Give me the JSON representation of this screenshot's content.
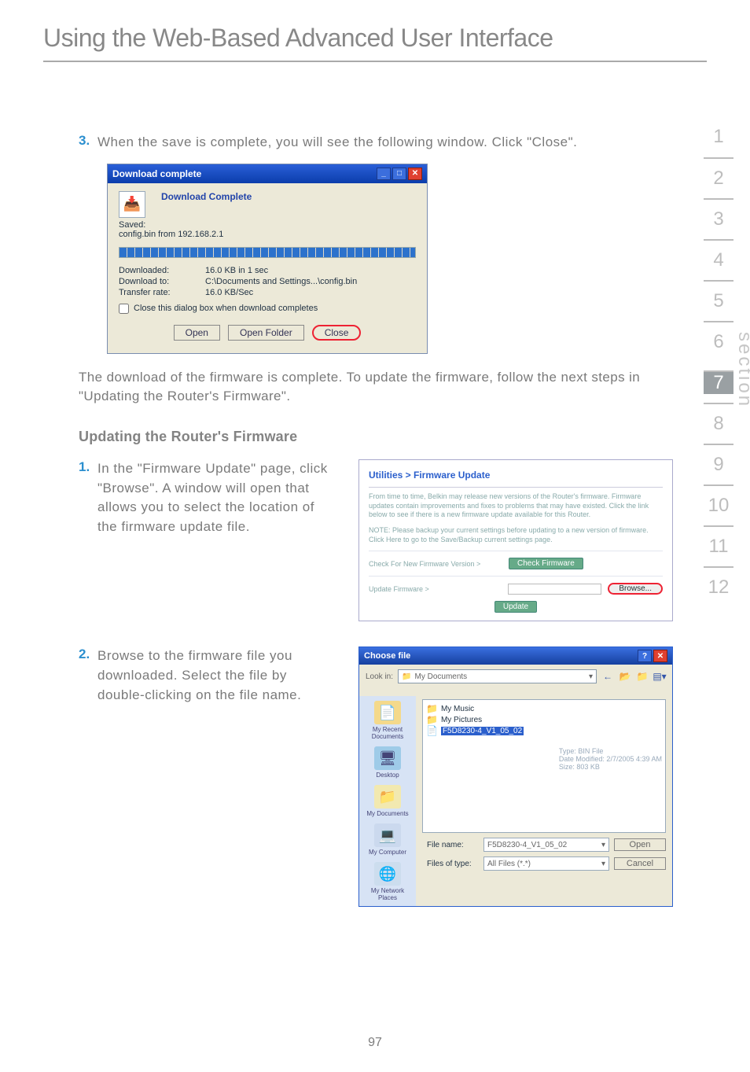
{
  "header": {
    "title": "Using the Web-Based Advanced User Interface"
  },
  "steps": {
    "s3": {
      "num": "3.",
      "text": "When the save is complete, you will see the following window. Click \"Close\"."
    },
    "after_dialog": "The download of the firmware is complete. To update the firmware, follow the next steps in \"Updating the Router's Firmware\".",
    "subheading": "Updating the Router's Firmware",
    "s1": {
      "num": "1.",
      "text": "In the \"Firmware Update\" page, click \"Browse\". A window will open that allows you to select the location of the firmware update file."
    },
    "s2": {
      "num": "2.",
      "text": "Browse to the firmware file you downloaded. Select the file by double-clicking on the file name."
    }
  },
  "download_dialog": {
    "title": "Download complete",
    "heading": "Download Complete",
    "saved_label": "Saved:",
    "saved_value": "config.bin from 192.168.2.1",
    "kv": {
      "downloaded_l": "Downloaded:",
      "downloaded_v": "16.0 KB in 1 sec",
      "downloadto_l": "Download to:",
      "downloadto_v": "C:\\Documents and Settings...\\config.bin",
      "transfer_l": "Transfer rate:",
      "transfer_v": "16.0 KB/Sec"
    },
    "checkbox": "Close this dialog box when download completes",
    "buttons": {
      "open": "Open",
      "openfolder": "Open Folder",
      "close": "Close"
    }
  },
  "fw_panel": {
    "breadcrumb": "Utilities > Firmware Update",
    "p1": "From time to time, Belkin may release new versions of the Router's firmware. Firmware updates contain improvements and fixes to problems that may have existed. Click the link below to see if there is a new firmware update available for this Router.",
    "p2": "NOTE: Please backup your current settings before updating to a new version of firmware. Click Here to go to the Save/Backup current settings page.",
    "check_label": "Check For New Firmware Version >",
    "check_btn": "Check Firmware",
    "update_label": "Update Firmware >",
    "browse_btn": "Browse...",
    "update_btn": "Update"
  },
  "file_dialog": {
    "title": "Choose file",
    "lookin_label": "Look in:",
    "lookin_value": "My Documents",
    "folders": {
      "f1": "My Music",
      "f2": "My Pictures",
      "f3_selected": "F5D8230-4_V1_05_02"
    },
    "info": {
      "type": "Type: BIN File",
      "date": "Date Modified: 2/7/2005 4:39 AM",
      "size": "Size: 803 KB"
    },
    "places": {
      "recent": "My Recent Documents",
      "desktop": "Desktop",
      "docs": "My Documents",
      "computer": "My Computer",
      "network": "My Network Places"
    },
    "fields": {
      "name_l": "File name:",
      "name_v": "F5D8230-4_V1_05_02",
      "type_l": "Files of type:",
      "type_v": "All Files (*.*)"
    },
    "buttons": {
      "open": "Open",
      "cancel": "Cancel"
    }
  },
  "sidebar": {
    "label": "section",
    "items": [
      "1",
      "2",
      "3",
      "4",
      "5",
      "6",
      "7",
      "8",
      "9",
      "10",
      "11",
      "12"
    ],
    "active": "7"
  },
  "footer": {
    "page": "97"
  }
}
